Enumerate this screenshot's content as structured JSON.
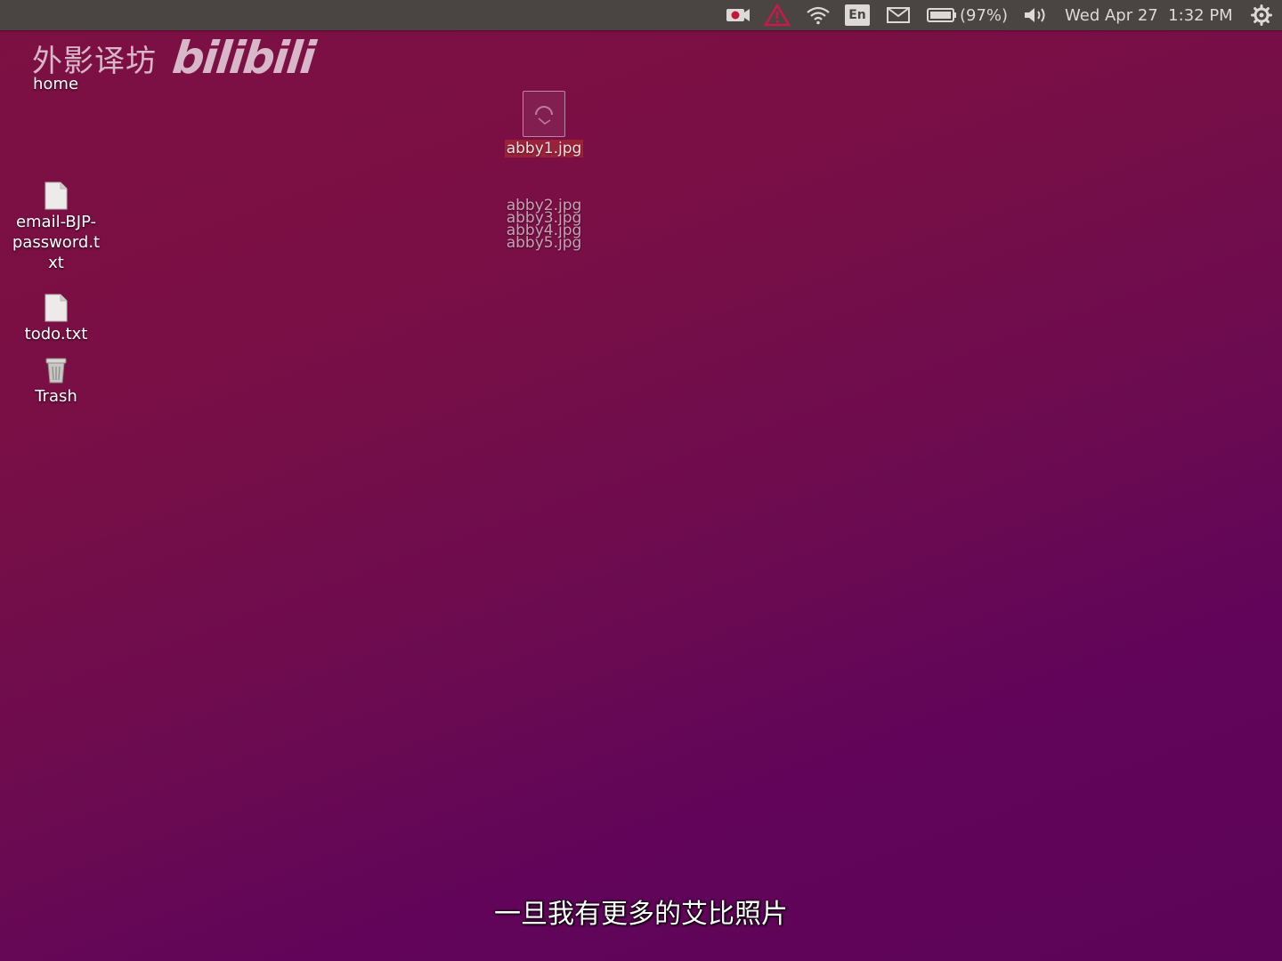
{
  "top_panel": {
    "battery_text": "(97%)",
    "clock": "Wed Apr 27  1:32 PM",
    "keyboard_layout": "En",
    "icons": [
      "video-record-icon",
      "update-alert-icon",
      "wifi-icon",
      "keyboard-icon",
      "mail-icon",
      "battery-icon",
      "volume-icon",
      "gear-icon"
    ]
  },
  "watermark": {
    "brand_cn": "外影译坊",
    "brand_logo": "bilibili"
  },
  "desktop": {
    "home_label": "home",
    "icons": [
      {
        "label": "email-BJP-password.txt",
        "icon": "text-file-icon"
      },
      {
        "label": "todo.txt",
        "icon": "text-file-icon"
      },
      {
        "label": "Trash",
        "icon": "trash-icon"
      }
    ],
    "drag_stack": {
      "primary": "abby1.jpg",
      "others": [
        "abby2.jpg",
        "abby3.jpg",
        "abby4.jpg",
        "abby5.jpg"
      ]
    }
  },
  "subtitle": "一旦我有更多的艾比照片",
  "colors": {
    "panel": "#4a4543",
    "wallpaper_top": "#7d1043",
    "wallpaper_bottom": "#5c0458",
    "text": "#dcdad6"
  }
}
